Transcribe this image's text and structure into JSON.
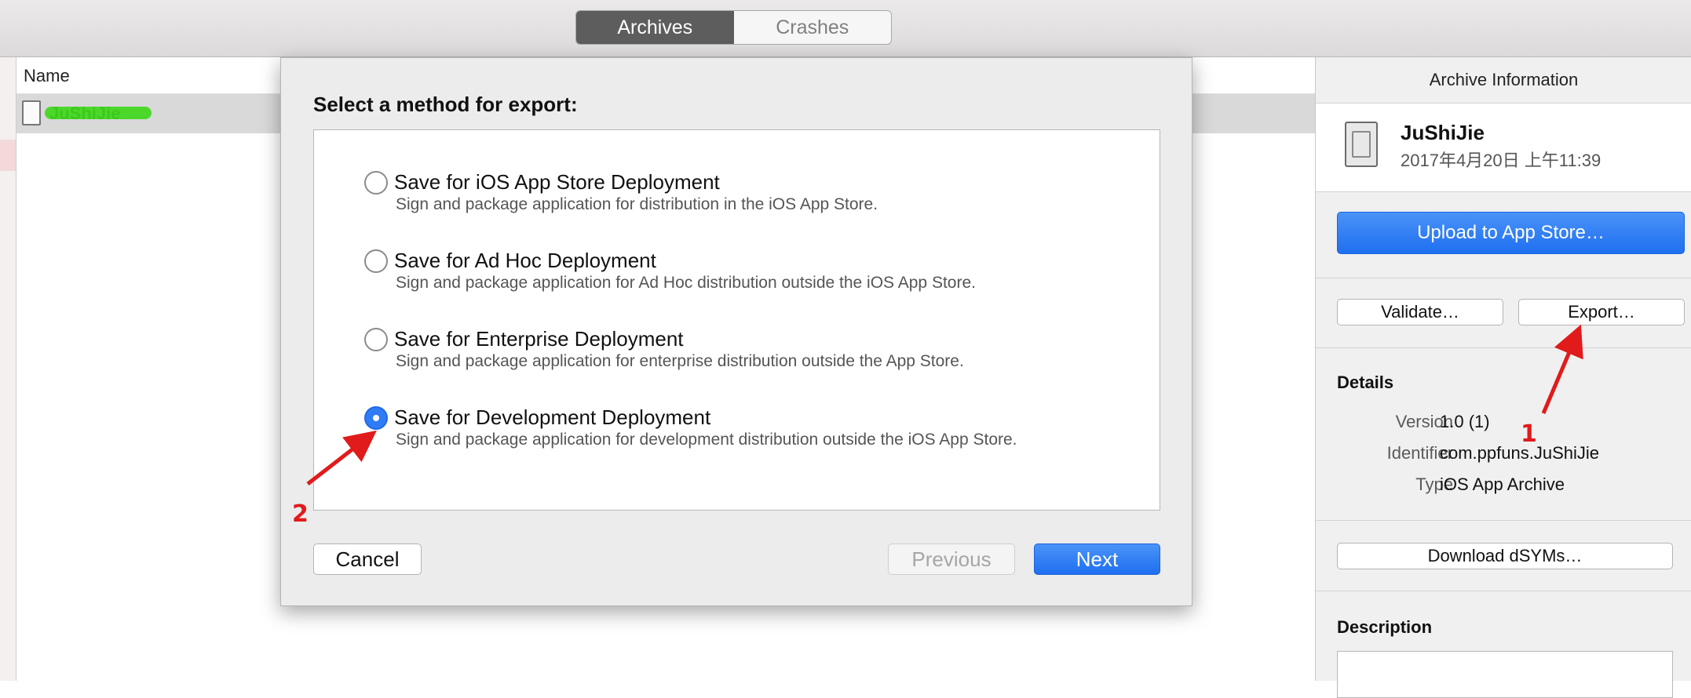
{
  "toolbar": {
    "tabs": [
      {
        "label": "Archives",
        "active": true
      },
      {
        "label": "Crashes",
        "active": false
      }
    ]
  },
  "list": {
    "column_name": "Name",
    "rows": [
      {
        "name": "JuShiJie"
      }
    ]
  },
  "export_sheet": {
    "title": "Select a method for export:",
    "options": [
      {
        "title": "Save for iOS App Store Deployment",
        "description": "Sign and package application for distribution in the iOS App Store.",
        "selected": false
      },
      {
        "title": "Save for Ad Hoc Deployment",
        "description": "Sign and package application for Ad Hoc distribution outside the iOS App Store.",
        "selected": false
      },
      {
        "title": "Save for Enterprise Deployment",
        "description": "Sign and package application for enterprise distribution outside the App Store.",
        "selected": false
      },
      {
        "title": "Save for Development Deployment",
        "description": "Sign and package application for development distribution outside the iOS App Store.",
        "selected": true
      }
    ],
    "cancel_label": "Cancel",
    "previous_label": "Previous",
    "next_label": "Next"
  },
  "inspector": {
    "header": "Archive Information",
    "app_name": "JuShiJie",
    "app_date": "2017年4月20日 上午11:39",
    "upload_label": "Upload to App Store…",
    "validate_label": "Validate…",
    "export_label": "Export…",
    "details_title": "Details",
    "details": [
      {
        "label": "Version",
        "value": "1.0 (1)"
      },
      {
        "label": "Identifier",
        "value": "com.ppfuns.JuShiJie"
      },
      {
        "label": "Type",
        "value": "iOS App Archive"
      }
    ],
    "dsym_label": "Download dSYMs…",
    "description_title": "Description"
  },
  "annotations": {
    "step1": "1",
    "step2": "2",
    "arrow_color": "#e11b1b"
  },
  "colors": {
    "accent_blue": "#1f6ff0",
    "segment_active": "#5d5d5d"
  }
}
